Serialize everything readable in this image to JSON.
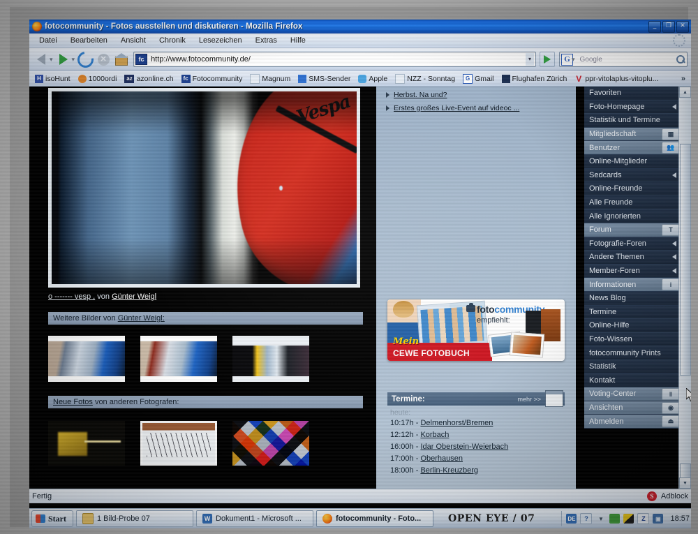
{
  "window": {
    "title": "fotocommunity - Fotos ausstellen und diskutieren - Mozilla Firefox",
    "minimize": "_",
    "maximize": "❐",
    "close": "✕"
  },
  "menubar": {
    "items": [
      "Datei",
      "Bearbeiten",
      "Ansicht",
      "Chronik",
      "Lesezeichen",
      "Extras",
      "Hilfe"
    ]
  },
  "navbar": {
    "back": "back-arrow",
    "forward": "forward-arrow",
    "reload": "reload-icon",
    "stop": "stop-icon",
    "home": "home-icon",
    "url": "http://www.fotocommunity.de/",
    "url_favicon": "fc",
    "go": "go-arrow",
    "search_engine": "G",
    "search_placeholder": "Google",
    "search_value": ""
  },
  "bookmarks": {
    "items": [
      {
        "label": "isoHunt",
        "icon": "H"
      },
      {
        "label": "1000ordi",
        "icon": "●"
      },
      {
        "label": "azonline.ch",
        "icon": "az"
      },
      {
        "label": "Fotocommunity",
        "icon": "fc"
      },
      {
        "label": "Magnum",
        "icon": "□"
      },
      {
        "label": "SMS-Sender",
        "icon": "✉"
      },
      {
        "label": "Apple",
        "icon": "●"
      },
      {
        "label": "NZZ - Sonntag",
        "icon": "□"
      },
      {
        "label": "Gmail",
        "icon": "G"
      },
      {
        "label": "Flughafen Zürich",
        "icon": "✈"
      },
      {
        "label": "ppr-vitolaplus-vitoplu...",
        "icon": "V"
      }
    ],
    "overflow": "»"
  },
  "page": {
    "news": [
      {
        "text": "Herbst. Na und?"
      },
      {
        "text": "Erstes großes Live-Event auf videoc ..."
      }
    ],
    "photo_caption_prefix": "o ------- vesp ,",
    "photo_caption_by": "von",
    "photo_author": "Günter Weigl",
    "more_images_prefix": "Weitere Bilder von",
    "more_images_author": "Günter Weigl:",
    "new_photos_link": "Neue Fotos",
    "new_photos_rest": "von anderen Fotografen:",
    "ad": {
      "brand_part1": "foto",
      "brand_part2": "community",
      "recommends": "empfiehlt:",
      "mein": "Mein",
      "product": "CEWE FOTOBUCH"
    },
    "termine": {
      "title": "Termine:",
      "more": "mehr >>",
      "today_label": "heute:",
      "entries": [
        {
          "time": "10:17h -",
          "place": "Delmenhorst/Bremen"
        },
        {
          "time": "12:12h -",
          "place": "Korbach"
        },
        {
          "time": "16:00h -",
          "place": "Idar Oberstein-Weierbach"
        },
        {
          "time": "17:00h -",
          "place": "Oberhausen"
        },
        {
          "time": "18:00h -",
          "place": "Berlin-Kreuzberg"
        }
      ]
    },
    "sidebar": [
      {
        "label": "Favoriten",
        "type": "item",
        "icon": ""
      },
      {
        "label": "Foto-Homepage",
        "type": "item",
        "icon": "arrow"
      },
      {
        "label": "Statistik und Termine",
        "type": "item",
        "icon": ""
      },
      {
        "label": "Mitgliedschaft",
        "type": "head",
        "icon": "grid"
      },
      {
        "label": "Benutzer",
        "type": "head",
        "icon": "users"
      },
      {
        "label": "Online-Mitglieder",
        "type": "item",
        "icon": ""
      },
      {
        "label": "Sedcards",
        "type": "item",
        "icon": "arrow"
      },
      {
        "label": "Online-Freunde",
        "type": "item",
        "icon": ""
      },
      {
        "label": "Alle Freunde",
        "type": "item",
        "icon": ""
      },
      {
        "label": "Alle Ignorierten",
        "type": "item",
        "icon": ""
      },
      {
        "label": "Forum",
        "type": "head",
        "icon": "text"
      },
      {
        "label": "Fotografie-Foren",
        "type": "item",
        "icon": "arrow"
      },
      {
        "label": "Andere Themen",
        "type": "item",
        "icon": "arrow"
      },
      {
        "label": "Member-Foren",
        "type": "item",
        "icon": "arrow"
      },
      {
        "label": "Informationen",
        "type": "head",
        "icon": "info"
      },
      {
        "label": "News Blog",
        "type": "item",
        "icon": ""
      },
      {
        "label": "Termine",
        "type": "item",
        "icon": ""
      },
      {
        "label": "Online-Hilfe",
        "type": "item",
        "icon": ""
      },
      {
        "label": "Foto-Wissen",
        "type": "item",
        "icon": ""
      },
      {
        "label": "fotocommunity Prints",
        "type": "item",
        "icon": ""
      },
      {
        "label": "Statistik",
        "type": "item",
        "icon": ""
      },
      {
        "label": "Kontakt",
        "type": "item",
        "icon": ""
      },
      {
        "label": "Voting-Center",
        "type": "head",
        "icon": "bars"
      },
      {
        "label": "Ansichten",
        "type": "head",
        "icon": "eye"
      },
      {
        "label": "Abmelden",
        "type": "head",
        "icon": "eject"
      }
    ]
  },
  "statusbar": {
    "text": "Fertig",
    "adblock_label": "Adblock",
    "adblock_icon": "S"
  },
  "taskbar": {
    "start": "Start",
    "buttons": [
      {
        "label": "1 Bild-Probe 07",
        "active": false,
        "icon": "folder"
      },
      {
        "label": "Dokument1 - Microsoft ...",
        "active": false,
        "icon": "word"
      },
      {
        "label": "fotocommunity - Foto...",
        "active": true,
        "icon": "firefox"
      }
    ],
    "watermark": "OPEN EYE / 07",
    "tray": [
      {
        "name": "language-indicator",
        "glyph": "DE"
      },
      {
        "name": "help-icon",
        "glyph": "?"
      },
      {
        "name": "updates-icon",
        "glyph": "▼"
      },
      {
        "name": "green-app-icon",
        "glyph": "◆"
      },
      {
        "name": "colors-icon",
        "glyph": "■"
      },
      {
        "name": "zone-alarm-icon",
        "glyph": "Z"
      },
      {
        "name": "network-icon",
        "glyph": "▣"
      }
    ],
    "clock": "18:57"
  },
  "colors": {
    "title_blue": "#1f79ea",
    "page_bg": "#000000",
    "sidebar_dark": "#1b293c",
    "sidebar_head": "#6f86a0",
    "mid_col": "#a9bccf",
    "accent_red": "#cf1722",
    "link_white": "#ffffff"
  }
}
